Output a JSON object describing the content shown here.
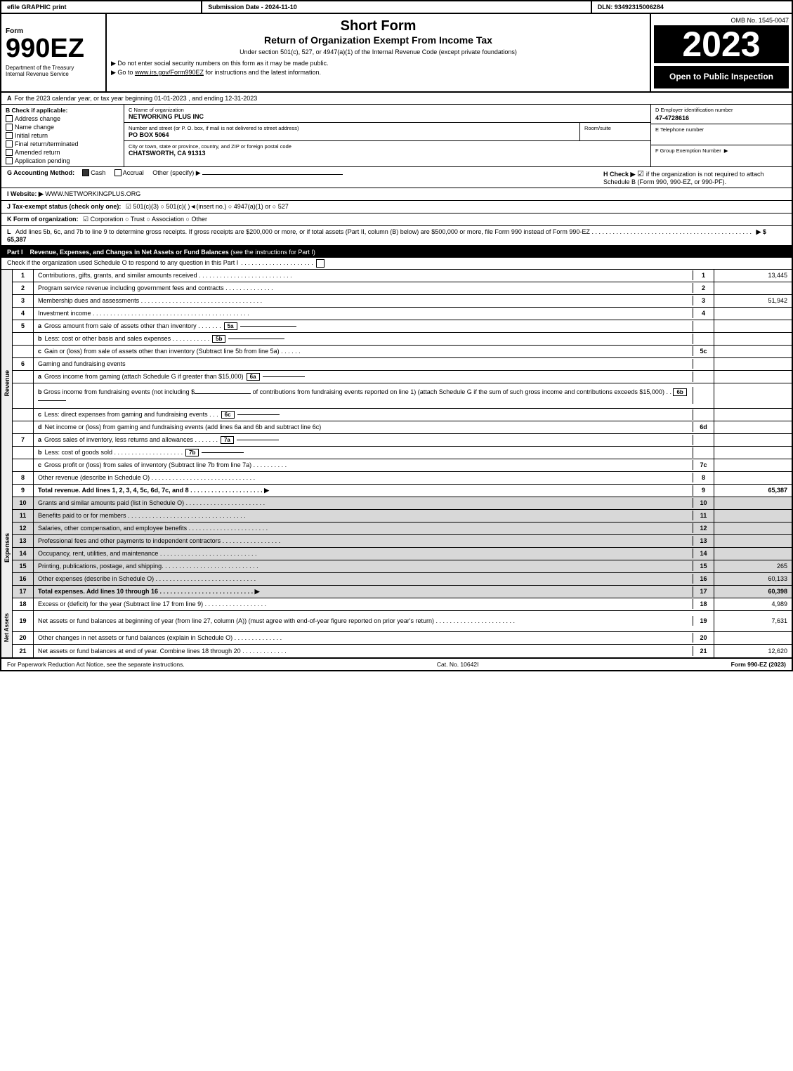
{
  "header": {
    "efile_label": "efile GRAPHIC print",
    "submission_label": "Submission Date - 2024-11-10",
    "dln_label": "DLN: 93492315006284",
    "form_number": "990EZ",
    "short_form_title": "Short Form",
    "return_title": "Return of Organization Exempt From Income Tax",
    "under_section": "Under section 501(c), 527, or 4947(a)(1) of the Internal Revenue Code (except private foundations)",
    "no_ssn": "▶ Do not enter social security numbers on this form as it may be made public.",
    "goto_irs": "▶ Go to www.irs.gov/Form990EZ for instructions and the latest information.",
    "omb": "OMB No. 1545-0047",
    "year": "2023",
    "open_to_public": "Open to Public Inspection"
  },
  "dept": {
    "name": "Department of the Treasury",
    "bureau": "Internal Revenue Service"
  },
  "section_a": {
    "label": "A",
    "tax_year_text": "For the 2023 calendar year, or tax year beginning 01-01-2023 , and ending 12-31-2023"
  },
  "section_b": {
    "label": "B Check if applicable:",
    "checkboxes": [
      {
        "id": "address_change",
        "label": "Address change",
        "checked": false
      },
      {
        "id": "name_change",
        "label": "Name change",
        "checked": false
      },
      {
        "id": "initial_return",
        "label": "Initial return",
        "checked": false
      },
      {
        "id": "final_return",
        "label": "Final return/terminated",
        "checked": false
      },
      {
        "id": "amended_return",
        "label": "Amended return",
        "checked": false
      },
      {
        "id": "application_pending",
        "label": "Application pending",
        "checked": false
      }
    ]
  },
  "section_c": {
    "label": "C Name of organization",
    "org_name": "NETWORKING PLUS INC",
    "address_label": "Number and street (or P. O. box, if mail is not delivered to street address)",
    "address_value": "PO BOX 5064",
    "room_label": "Room/suite",
    "room_value": "",
    "city_label": "City or town, state or province, country, and ZIP or foreign postal code",
    "city_value": "CHATSWORTH, CA  91313"
  },
  "section_d": {
    "label": "D Employer identification number",
    "ein": "47-4728616"
  },
  "section_e": {
    "label": "E Telephone number",
    "phone": ""
  },
  "section_f": {
    "label": "F Group Exemption Number",
    "arrow": "▶",
    "value": ""
  },
  "section_g": {
    "label": "G Accounting Method:",
    "cash": "Cash",
    "accrual": "Accrual",
    "other": "Other (specify) ▶",
    "cash_checked": true,
    "accrual_checked": false
  },
  "section_h": {
    "label": "H Check ▶",
    "check_symbol": "☑",
    "text": "if the organization is not required to attach Schedule B (Form 990, 990-EZ, or 990-PF).",
    "checked": true
  },
  "section_i": {
    "label": "I Website: ▶",
    "url": "WWW.NETWORKINGPLUS.ORG"
  },
  "section_j": {
    "label": "J Tax-exempt status (check only one):",
    "options": "☑ 501(c)(3)  ○ 501(c)(  )◄(insert no.)  ○ 4947(a)(1) or  ○ 527"
  },
  "section_k": {
    "label": "K Form of organization:",
    "options": "☑ Corporation   ○ Trust   ○ Association   ○ Other"
  },
  "section_l": {
    "label": "L",
    "text": "Add lines 5b, 6c, and 7b to line 9 to determine gross receipts. If gross receipts are $200,000 or more, or if total assets (Part II, column (B) below) are $500,000 or more, file Form 990 instead of Form 990-EZ",
    "dots": ". . . . . . . . . . . . . . . . . . . . . . . . . . . . . . . . . . . . . . . . . . . . . .",
    "arrow": "▶ $",
    "value": "65,387"
  },
  "part1": {
    "label": "Part I",
    "title": "Revenue, Expenses, and Changes in Net Assets or Fund Balances",
    "see_instructions": "(see the instructions for Part I)",
    "schedule_o_text": "Check if the organization used Schedule O to respond to any question in this Part I",
    "dots": ". . . . . . . . . . . . . . . . . . . . .",
    "rows": [
      {
        "num": "1",
        "sub": "",
        "desc": "Contributions, gifts, grants, and similar amounts received",
        "dots": ". . . . . . . . . . . . . . . . . . . . . . . . . . .",
        "line_num": "1",
        "value": "13,445",
        "shaded": false
      },
      {
        "num": "2",
        "sub": "",
        "desc": "Program service revenue including government fees and contracts",
        "dots": ". . . . . . . . . . . . . . .",
        "line_num": "2",
        "value": "",
        "shaded": false
      },
      {
        "num": "3",
        "sub": "",
        "desc": "Membership dues and assessments",
        "dots": ". . . . . . . . . . . . . . . . . . . . . . . . . . . . . . . . . . . .",
        "line_num": "3",
        "value": "51,942",
        "shaded": false
      },
      {
        "num": "4",
        "sub": "",
        "desc": "Investment income",
        "dots": ". . . . . . . . . . . . . . . . . . . . . . . . . . . . . . . . . . . . . . . . . . . . . . . .",
        "line_num": "4",
        "value": "",
        "shaded": false
      },
      {
        "num": "5",
        "sub": "a",
        "desc": "Gross amount from sale of assets other than inventory . . . . . . .",
        "inline_box": "5a",
        "dots": "",
        "line_num": "",
        "value": "",
        "shaded": false
      },
      {
        "num": "",
        "sub": "b",
        "desc": "Less: cost or other basis and sales expenses . . . . . . . . . . .",
        "inline_box": "5b",
        "dots": "",
        "line_num": "",
        "value": "",
        "shaded": false
      },
      {
        "num": "",
        "sub": "c",
        "desc": "Gain or (loss) from sale of assets other than inventory (Subtract line 5b from line 5a) . . . . . .",
        "dots": "",
        "line_num": "5c",
        "value": "",
        "shaded": false
      },
      {
        "num": "6",
        "sub": "",
        "desc": "Gaming and fundraising events",
        "dots": "",
        "line_num": "",
        "value": "",
        "shaded": false
      },
      {
        "num": "",
        "sub": "a",
        "desc": "Gross income from gaming (attach Schedule G if greater than $15,000)",
        "inline_box": "6a",
        "dots": "",
        "line_num": "",
        "value": "",
        "shaded": false
      },
      {
        "num": "",
        "sub": "b",
        "desc": "Gross income from fundraising events (not including $___________of contributions from fundraising events reported on line 1) (attach Schedule G if the sum of such gross income and contributions exceeds $15,000)  .  .",
        "inline_box": "6b",
        "dots": "",
        "line_num": "",
        "value": "",
        "shaded": false
      },
      {
        "num": "",
        "sub": "c",
        "desc": "Less: direct expenses from gaming and fundraising events  .  .  .",
        "inline_box": "6c",
        "dots": "",
        "line_num": "",
        "value": "",
        "shaded": false
      },
      {
        "num": "",
        "sub": "d",
        "desc": "Net income or (loss) from gaming and fundraising events (add lines 6a and 6b and subtract line 6c)",
        "dots": "",
        "line_num": "6d",
        "value": "",
        "shaded": false
      },
      {
        "num": "7",
        "sub": "a",
        "desc": "Gross sales of inventory, less returns and allowances . . . . . . .",
        "inline_box": "7a",
        "dots": "",
        "line_num": "",
        "value": "",
        "shaded": false
      },
      {
        "num": "",
        "sub": "b",
        "desc": "Less: cost of goods sold  . . . . . . . . . . . . . . . . . . . .",
        "inline_box": "7b",
        "dots": "",
        "line_num": "",
        "value": "",
        "shaded": false
      },
      {
        "num": "",
        "sub": "c",
        "desc": "Gross profit or (loss) from sales of inventory (Subtract line 7b from line 7a) . . . . . . . . . .",
        "dots": "",
        "line_num": "7c",
        "value": "",
        "shaded": false
      },
      {
        "num": "8",
        "sub": "",
        "desc": "Other revenue (describe in Schedule O) . . . . . . . . . . . . . . . . . . . . . . . . . . . . . .",
        "dots": "",
        "line_num": "8",
        "value": "",
        "shaded": false
      },
      {
        "num": "9",
        "sub": "",
        "desc": "Total revenue. Add lines 1, 2, 3, 4, 5c, 6d, 7c, and 8 . . . . . . . . . . . . . . . . . . . . .",
        "arrow": "▶",
        "line_num": "9",
        "value": "65,387",
        "shaded": false,
        "bold": true
      }
    ]
  },
  "expenses": {
    "label": "Expenses",
    "rows": [
      {
        "num": "10",
        "desc": "Grants and similar amounts paid (list in Schedule O) . . . . . . . . . . . . . . . . . . . . . . .",
        "value": "",
        "shaded": true
      },
      {
        "num": "11",
        "desc": "Benefits paid to or for members . . . . . . . . . . . . . . . . . . . . . . . . . . . . . . . . . .",
        "value": "",
        "shaded": true
      },
      {
        "num": "12",
        "desc": "Salaries, other compensation, and employee benefits . . . . . . . . . . . . . . . . . . . . . . .",
        "value": "",
        "shaded": true
      },
      {
        "num": "13",
        "desc": "Professional fees and other payments to independent contractors . . . . . . . . . . . . . . . . .",
        "value": "",
        "shaded": true
      },
      {
        "num": "14",
        "desc": "Occupancy, rent, utilities, and maintenance . . . . . . . . . . . . . . . . . . . . . . . . . . . .",
        "value": "",
        "shaded": true
      },
      {
        "num": "15",
        "desc": "Printing, publications, postage, and shipping. . . . . . . . . . . . . . . . . . . . . . . . . . . .",
        "value": "265",
        "shaded": true
      },
      {
        "num": "16",
        "desc": "Other expenses (describe in Schedule O) . . . . . . . . . . . . . . . . . . . . . . . . . . . . .",
        "value": "60,133",
        "shaded": true
      },
      {
        "num": "17",
        "desc": "Total expenses. Add lines 10 through 16  . . . . . . . . . . . . . . . . . . . . . . . . . . . . .",
        "value": "60,398",
        "bold": true,
        "arrow": "▶",
        "shaded": true
      }
    ]
  },
  "net_assets": {
    "label": "Net Assets",
    "rows": [
      {
        "num": "18",
        "desc": "Excess or (deficit) for the year (Subtract line 17 from line 9)  . . . . . . . . . . . . . . . . . .",
        "value": "4,989",
        "shaded": false
      },
      {
        "num": "19",
        "desc": "Net assets or fund balances at beginning of year (from line 27, column (A)) (must agree with end-of-year figure reported on prior year's return) . . . . . . . . . . . . . . . . . . . . . . .",
        "value": "7,631",
        "shaded": false
      },
      {
        "num": "20",
        "desc": "Other changes in net assets or fund balances (explain in Schedule O) . . . . . . . . . . . . . .",
        "value": "",
        "shaded": false
      },
      {
        "num": "21",
        "desc": "Net assets or fund balances at end of year. Combine lines 18 through 20 . . . . . . . . . . . . .",
        "value": "12,620",
        "shaded": false
      }
    ]
  },
  "footer": {
    "paperwork_text": "For Paperwork Reduction Act Notice, see the separate instructions.",
    "cat_no": "Cat. No. 10642I",
    "form_label": "Form 990-EZ (2023)"
  }
}
